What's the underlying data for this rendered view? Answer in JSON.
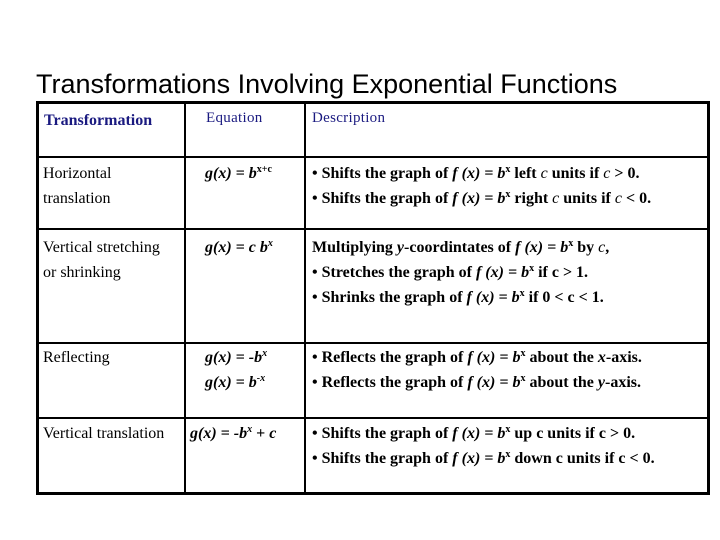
{
  "title": "Transformations Involving Exponential Functions",
  "header": {
    "transformation": "Transformation",
    "equation": "Equation",
    "description": "Description"
  },
  "colors": {
    "header_text": "#1a1a80",
    "border": "#000000",
    "body_text": "#000000"
  },
  "rows": [
    {
      "transformation": [
        "Horizontal",
        "translation"
      ],
      "equations": [
        {
          "lhs": "g(x) = ",
          "base": "b",
          "exp": "x+c"
        }
      ],
      "description": [
        {
          "prefix": "• Shifts the graph of ",
          "fx": "f (x) = ",
          "base": "b",
          "exp": "x",
          "suffix_pre": "  left ",
          "var": "c",
          "suffix_post": " units if ",
          "cond_var": "c",
          "cond": " > 0."
        },
        {
          "prefix": "• Shifts the graph of ",
          "fx": "f (x) = ",
          "base": "b",
          "exp": "x",
          "suffix_pre": "  right ",
          "var": "c",
          "suffix_post": " units if ",
          "cond_var": "c",
          "cond": " < 0."
        }
      ]
    },
    {
      "transformation": [
        "Vertical stretching",
        "or shrinking"
      ],
      "equations": [
        {
          "lhs": "g(x) = ",
          "coef": "c ",
          "base": "b",
          "exp": "x"
        }
      ],
      "description": [
        {
          "lead": "Multiplying ",
          "lead_var": "y",
          "lead_rest": "-coordintates of ",
          "fx": "f (x) = ",
          "base": "b",
          "exp": "x",
          "tail": " by ",
          "tail_var": "c",
          "tail_end": ","
        },
        {
          "prefix": "• Stretches the graph of ",
          "fx": "f (x) = ",
          "base": "b",
          "exp": "x",
          "tail": " if c > 1."
        },
        {
          "prefix": "• Shrinks the graph of ",
          "fx": "f (x) = ",
          "base": "b",
          "exp": "x",
          "tail": " if 0 < c < 1."
        }
      ]
    },
    {
      "transformation": [
        "Reflecting"
      ],
      "equations": [
        {
          "lhs": "g(x) = -",
          "base": "b",
          "exp": "x"
        },
        {
          "lhs": "g(x) = ",
          "base": "b",
          "exp": "-x"
        }
      ],
      "description": [
        {
          "prefix": "• Reflects the graph of ",
          "fx": "f (x) = ",
          "base": "b",
          "exp": "x",
          "tail": " about the ",
          "axis": "x",
          "axis_rest": "-axis."
        },
        {
          "prefix": "• Reflects the graph of ",
          "fx": "f (x) = ",
          "base": "b",
          "exp": "x",
          "tail": " about the ",
          "axis": "y",
          "axis_rest": "-axis."
        }
      ]
    },
    {
      "transformation": [
        "Vertical translation"
      ],
      "equations": [
        {
          "lhs": "g(x) = -",
          "base": "b",
          "exp": "x",
          "rest": " + ",
          "rest_var": "c"
        }
      ],
      "description": [
        {
          "prefix": "• Shifts the graph of ",
          "fx": "f (x) = ",
          "base": "b",
          "exp": "x",
          "tail": " up c units if c > 0."
        },
        {
          "prefix": "• Shifts the graph of ",
          "fx": "f (x) = ",
          "base": "b",
          "exp": "x",
          "tail": " down c units if c < 0."
        }
      ]
    }
  ]
}
